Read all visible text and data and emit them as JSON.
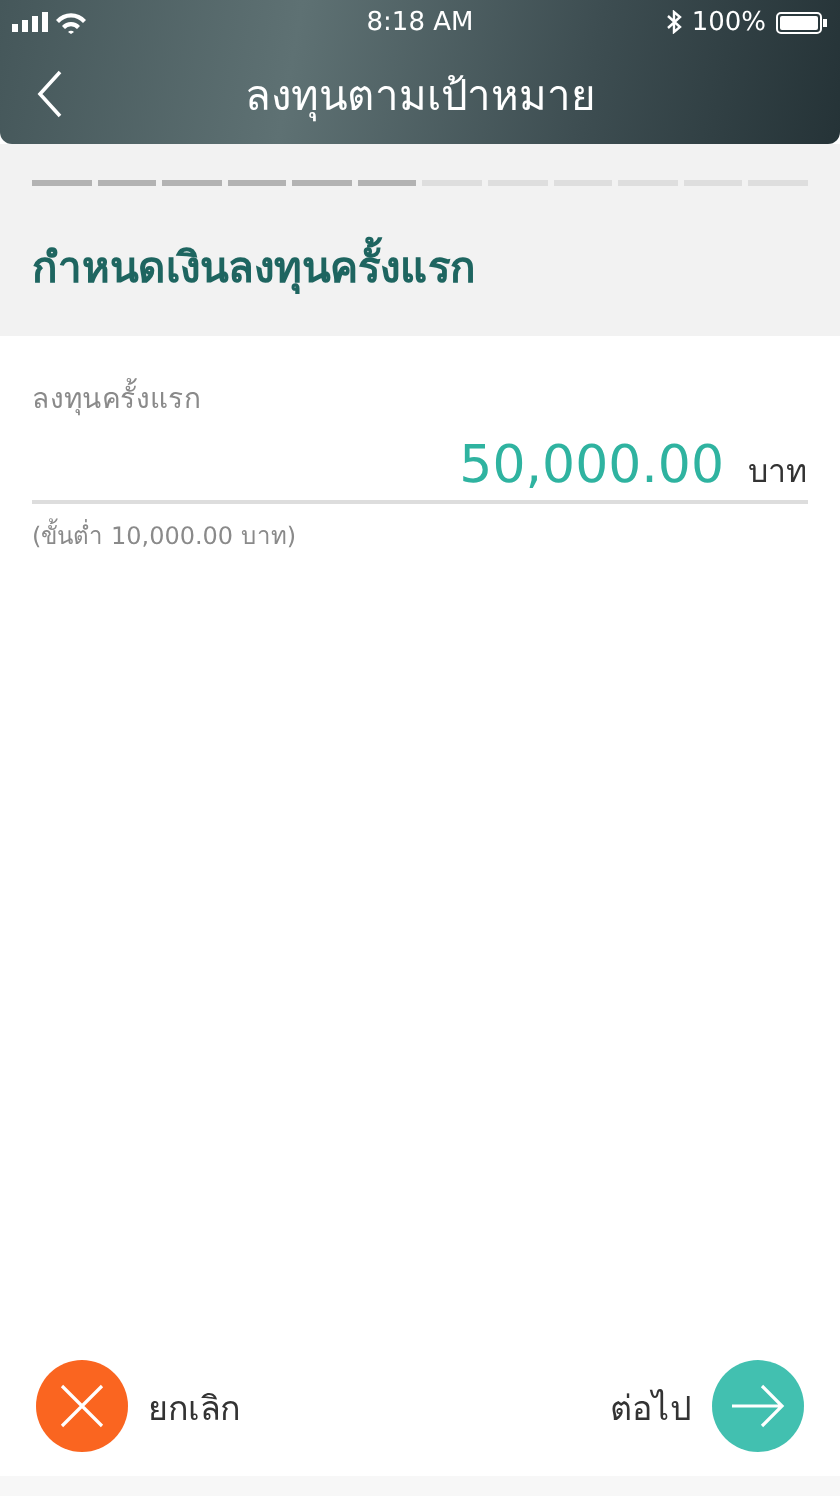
{
  "status_bar": {
    "time": "8:18 AM",
    "battery": "100%"
  },
  "header": {
    "title": "ลงทุนตามเป้าหมาย"
  },
  "progress": [
    {
      "done": true
    },
    {
      "done": true
    },
    {
      "done": true
    },
    {
      "done": true
    },
    {
      "done": true
    },
    {
      "done": true
    },
    {
      "done": false
    },
    {
      "done": false
    },
    {
      "done": false
    },
    {
      "done": false
    },
    {
      "done": false
    },
    {
      "done": false
    }
  ],
  "section_title": "กำหนดเงินลงทุนครั้งแรก",
  "field": {
    "label": "ลงทุนครั้งแรก",
    "value": "50,000.00",
    "unit": "บาท",
    "hint": "(ขั้นต่ำ 10,000.00 บาท)"
  },
  "actions": {
    "cancel": "ยกเลิก",
    "next": "ต่อไป"
  }
}
